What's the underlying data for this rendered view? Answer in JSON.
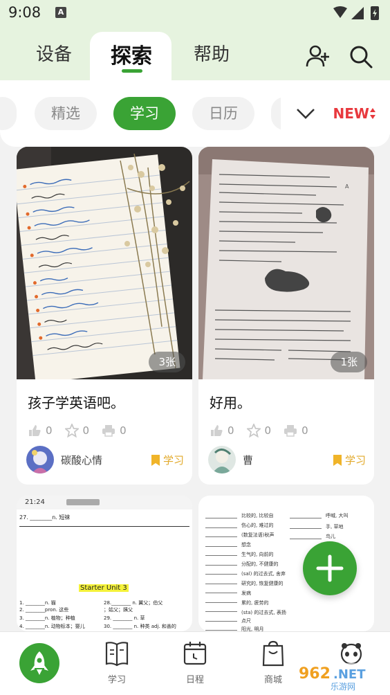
{
  "status_bar": {
    "time": "9:08",
    "notification_letter": "A"
  },
  "top_tabs": [
    {
      "label": "设备"
    },
    {
      "label": "探索",
      "active": true
    },
    {
      "label": "帮助"
    }
  ],
  "header_icons": [
    "add-user-icon",
    "search-icon"
  ],
  "filters": {
    "chips": [
      {
        "label": "精选"
      },
      {
        "label": "学习",
        "active": true
      },
      {
        "label": "日历"
      }
    ],
    "new_label": "NEW"
  },
  "cards": [
    {
      "title": "孩子学英语吧。",
      "image_count": "3张",
      "likes": "0",
      "favorites": "0",
      "prints": "0",
      "author": "碳酸心情",
      "category": "学习"
    },
    {
      "title": "好用。",
      "image_count": "1张",
      "likes": "0",
      "favorites": "0",
      "prints": "0",
      "author": "曹",
      "category": "学习"
    },
    {
      "image_header_time": "21:24",
      "image_line1": "27. ________n. 短袜",
      "image_highlight": "Starter Unit 3",
      "image_rows": [
        "1. ________n. 猫",
        "2. ________pron. 这些",
        "3. ________n. 植物；种植",
        "4. ________n. 动物标本；婴儿"
      ],
      "image_rows_right": [
        "28.________ n. 翼父；伯父",
        "；姑父；姨父",
        "29. ________ n. 草",
        "30. ________ n. 种类 adj. 和善的"
      ]
    },
    {
      "image_rows_left": [
        "比较的, 比较自",
        "伤心的, 难过的",
        "(数复法语)秋声",
        "想念",
        "生气的, 向前的",
        "分配的, 不健康的",
        "(sal) 的过去式, 舍弃",
        "研究的, 恢复健康的",
        "发病",
        "累的, 疲劳的",
        "(sta) 的过去式, 表扬",
        "点尺",
        "阳光, 明月"
      ],
      "image_rows_right": [
        "呼喊, 大叫",
        "手, 草地",
        "鸟儿"
      ]
    }
  ],
  "bottom_nav": [
    {
      "label": "",
      "icon": "rocket-icon",
      "active": true
    },
    {
      "label": "学习",
      "icon": "book-icon"
    },
    {
      "label": "日程",
      "icon": "calendar-icon"
    },
    {
      "label": "商城",
      "icon": "shopping-bag-icon"
    },
    {
      "label": "",
      "icon": "mascot-icon"
    }
  ],
  "watermark": "962.NET 乐游网",
  "colors": {
    "accent": "#3aa335",
    "header_bg": "#e6f3df",
    "new_badge": "#e8383d",
    "category": "#e2a92a"
  }
}
